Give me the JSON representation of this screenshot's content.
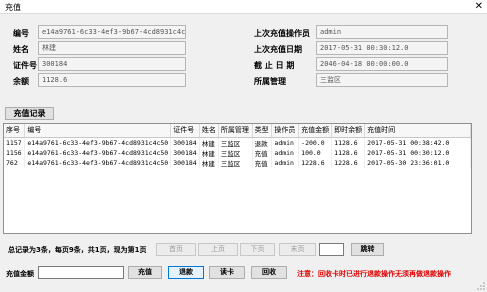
{
  "window": {
    "title": "充值",
    "close_symbol": "✕"
  },
  "info": {
    "card_no_label": "编号",
    "card_no": "e14a9761-6c33-4ef3-9b67-4cd8931c4c50",
    "name_label": "姓名",
    "name": "林建",
    "cert_label": "证件号",
    "cert": "300184",
    "balance_label": "余额",
    "balance": "1128.6",
    "last_operator_label": "上次充值操作员",
    "last_operator": "admin",
    "last_date_label": "上次充值日期",
    "last_date": "2017-05-31 00:30:12.0",
    "expire_label": "截 止 日 期",
    "expire": "2046-04-18 00:00:00.0",
    "dept_label": "所属管理",
    "dept": "三监区"
  },
  "records": {
    "section_label": "充值记录",
    "columns": [
      "序号",
      "编号",
      "证件号",
      "姓名",
      "所属管理",
      "类型",
      "操作员",
      "充值金额",
      "即时余额",
      "充值时间"
    ],
    "rows": [
      [
        "1157",
        "e14a9761-6c33-4ef3-9b67-4cd8931c4c50",
        "300184",
        "林建",
        "三监区",
        "退款",
        "admin",
        "-200.0",
        "1128.6",
        "2017-05-31 00:38:42.0"
      ],
      [
        "1156",
        "e14a9761-6c33-4ef3-9b67-4cd8931c4c50",
        "300184",
        "林建",
        "三监区",
        "充值",
        "admin",
        "100.0",
        "1128.6",
        "2017-05-31 00:30:12.0"
      ],
      [
        "762",
        "e14a9761-6c33-4ef3-9b67-4cd8931c4c50",
        "300184",
        "林建",
        "三监区",
        "充值",
        "admin",
        "1228.6",
        "1228.6",
        "2017-05-30 23:36:01.0"
      ]
    ]
  },
  "pager": {
    "summary": "总记录为3条，每页9条，共1页，现为第1页",
    "first": "首页",
    "prev": "上页",
    "next": "下页",
    "last": "末页",
    "goto_value": "",
    "goto": "跳转"
  },
  "actions": {
    "amount_label": "充值金额",
    "amount_value": "",
    "recharge": "充值",
    "refund": "退款",
    "read_card": "读卡",
    "back": "回收"
  },
  "notice": "注意：回收卡时已进行退款操作无须再做退款操作"
}
